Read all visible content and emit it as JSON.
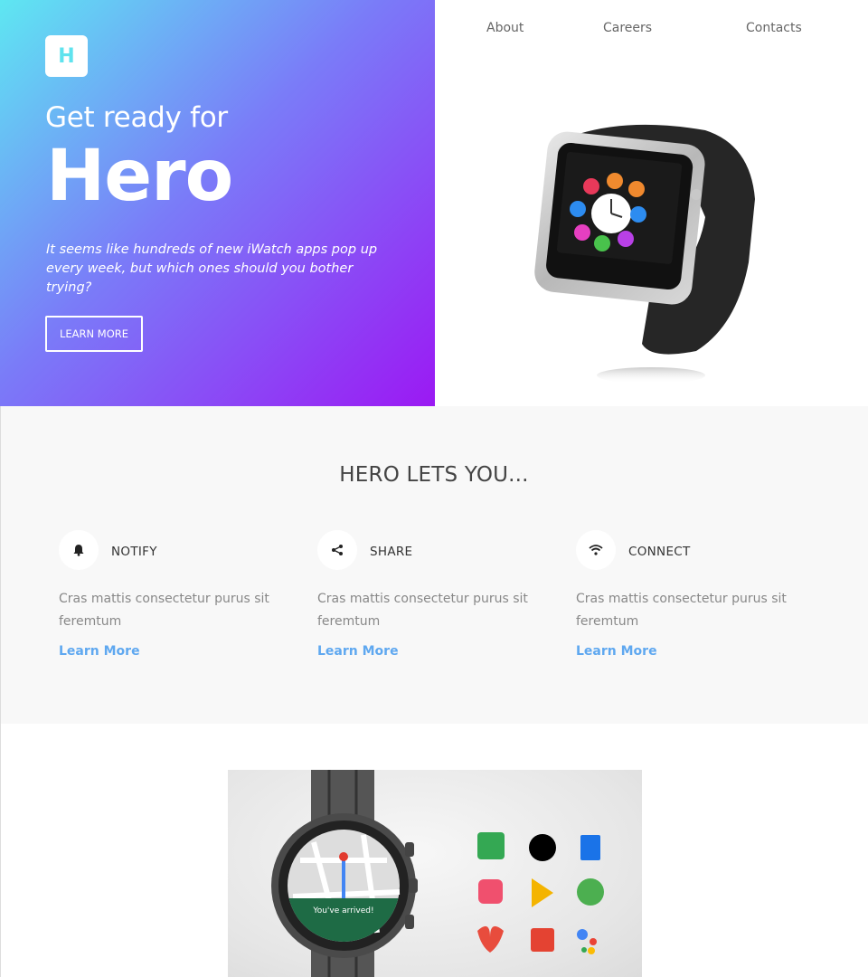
{
  "brand": {
    "logo_letter": "H"
  },
  "nav": {
    "items": [
      "About",
      "Careers",
      "Contacts"
    ]
  },
  "hero": {
    "subtitle": "Get ready for",
    "title": "Hero",
    "description": "It seems like hundreds of new iWatch apps pop up every week, but which ones should you bother trying?",
    "button_label": "LEARN MORE"
  },
  "features": {
    "title": "HERO LETS YOU...",
    "items": [
      {
        "name": "NOTIFY",
        "icon": "bell-icon",
        "text": "Cras mattis consectetur purus sit feremtum",
        "link": "Learn More"
      },
      {
        "name": "SHARE",
        "icon": "share-icon",
        "text": "Cras mattis consectetur purus sit feremtum",
        "link": "Learn More"
      },
      {
        "name": "CONNECT",
        "icon": "wifi-icon",
        "text": "Cras mattis consectetur purus sit feremtum",
        "link": "Learn More"
      }
    ]
  },
  "promo": {
    "watch_message": "You've arrived!"
  },
  "colors": {
    "gradient_start": "#5ee7f2",
    "gradient_end": "#9b19f3",
    "link": "#5fa8f0",
    "section_bg": "#f8f8f8"
  }
}
